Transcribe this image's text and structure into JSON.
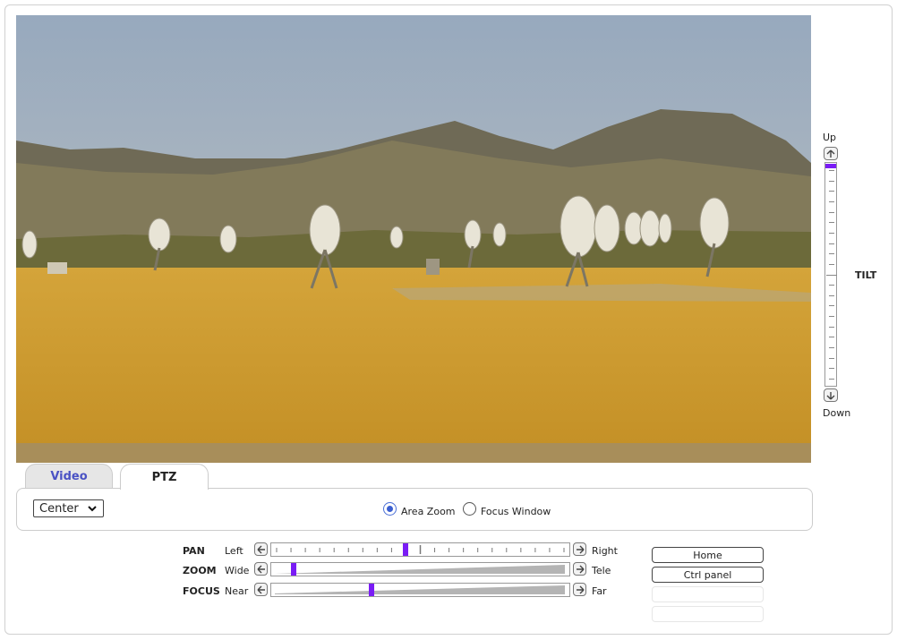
{
  "tilt": {
    "up_label": "Up",
    "down_label": "Down",
    "title": "TILT",
    "position": 0.0
  },
  "tabs": [
    {
      "label": "Video",
      "active": false
    },
    {
      "label": "PTZ",
      "active": true
    }
  ],
  "controls": {
    "preset_value": "Center",
    "radio_options": [
      {
        "label": "Area Zoom",
        "checked": true
      },
      {
        "label": "Focus Window",
        "checked": false
      }
    ]
  },
  "ptz": {
    "pan": {
      "label": "PAN",
      "min_label": "Left",
      "max_label": "Right",
      "position": 0.44
    },
    "zoom": {
      "label": "ZOOM",
      "min_label": "Wide",
      "max_label": "Tele",
      "position": 0.05
    },
    "focus": {
      "label": "FOCUS",
      "min_label": "Near",
      "max_label": "Far",
      "position": 0.32
    }
  },
  "buttons": {
    "home": "Home",
    "ctrl_panel": "Ctrl panel"
  },
  "colors": {
    "accent": "#7a1cf5",
    "video_tab_text": "#4a52c4"
  }
}
